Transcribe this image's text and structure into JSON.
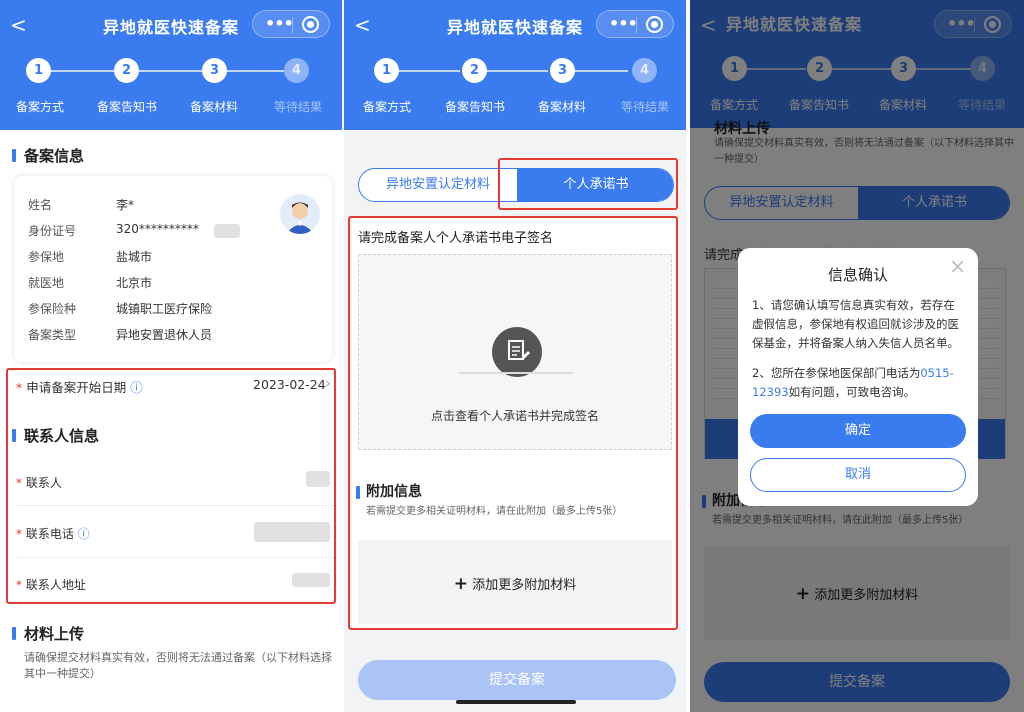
{
  "app": {
    "title": "异地就医快速备案",
    "back_glyph": "<",
    "menu_glyph": "•••"
  },
  "steps": [
    {
      "num": "1",
      "label": "备案方式"
    },
    {
      "num": "2",
      "label": "备案告知书"
    },
    {
      "num": "3",
      "label": "备案材料"
    },
    {
      "num": "4",
      "label": "等待结果"
    }
  ],
  "panel1": {
    "filing_info": {
      "title": "备案信息",
      "rows": [
        {
          "label": "姓名",
          "value": "李*"
        },
        {
          "label": "身份证号",
          "value": "320**********"
        },
        {
          "label": "参保地",
          "value": "盐城市"
        },
        {
          "label": "就医地",
          "value": "北京市"
        },
        {
          "label": "参保险种",
          "value": "城镇职工医疗保险"
        },
        {
          "label": "备案类型",
          "value": "异地安置退休人员"
        }
      ]
    },
    "start_date": {
      "required": "*",
      "label": "申请备案开始日期",
      "info_glyph": "ⓘ",
      "value": "2023-02-24",
      "chevron": "›"
    },
    "contact": {
      "title": "联系人信息",
      "fields": [
        {
          "required": "*",
          "label": "联系人",
          "info_glyph": ""
        },
        {
          "required": "*",
          "label": "联系电话",
          "info_glyph": "ⓘ"
        },
        {
          "required": "*",
          "label": "联系人地址",
          "info_glyph": ""
        }
      ]
    },
    "materials": {
      "title": "材料上传",
      "note": "请确保提交材料真实有效，否则将无法通过备案（以下材料选择其中一种提交）"
    }
  },
  "panel2": {
    "tabs": [
      "异地安置认定材料",
      "个人承诺书"
    ],
    "sign_title": "请完成备案人个人承诺书电子签名",
    "sign_hint": "点击查看个人承诺书并完成签名",
    "extra_title": "附加信息",
    "extra_note": "若需提交更多相关证明材料，请在此附加（最多上传5张）",
    "add_more": "添加更多附加材料",
    "plus": "+",
    "submit": "提交备案"
  },
  "panel3": {
    "bg_materials_title": "材料上传",
    "bg_note": "请确保提交材料真实有效，否则将无法通过备案（以下材料选择其中一种提交）",
    "bg_sign_title": "请完成备案人个人承诺书电子签名",
    "bg_extra_title": "附加信息",
    "dialog": {
      "title": "信息确认",
      "close": "×",
      "p1": "1、请您确认填写信息真实有效，若存在虚假信息，参保地有权追回就诊涉及的医保基金，并将备案人纳入失信人员名单。",
      "p2_before": "2、您所在参保地医保部门电话为",
      "p2_phone": "0515-12393",
      "p2_after": "如有问题，可致电咨询。",
      "confirm": "确定",
      "cancel": "取消"
    }
  },
  "colors": {
    "brand": "#3b7bf0",
    "highlight": "#e53935",
    "submit_disabled": "#a9c4f5"
  }
}
